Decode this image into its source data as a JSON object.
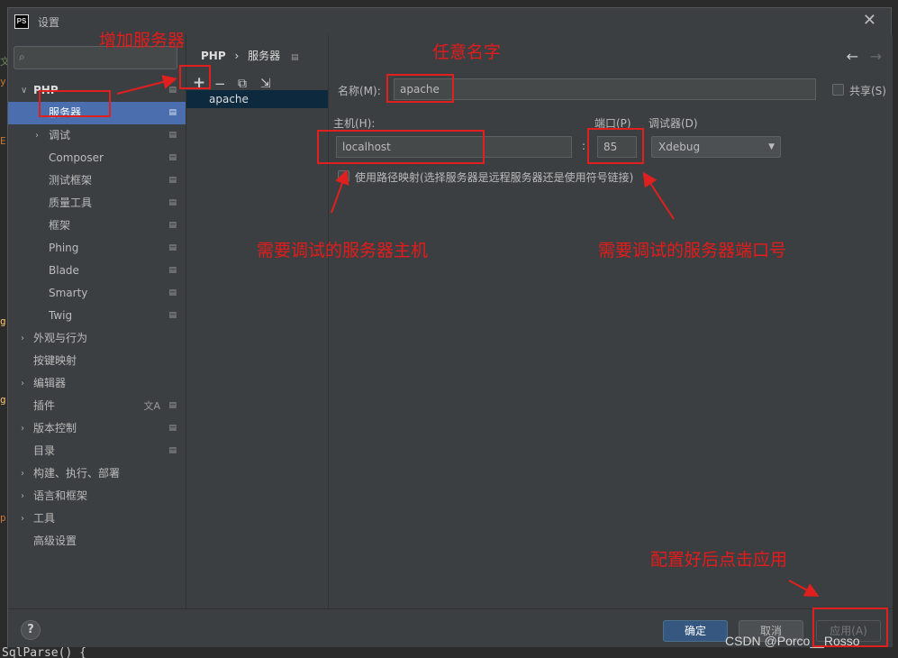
{
  "window": {
    "title": "设置",
    "logo": "PS"
  },
  "sidebar": {
    "search_placeholder": "",
    "items": [
      {
        "label": "PHP",
        "arrow": "∨"
      },
      {
        "label": "服务器"
      },
      {
        "label": "调试",
        "arrow": "›"
      },
      {
        "label": "Composer"
      },
      {
        "label": "测试框架"
      },
      {
        "label": "质量工具"
      },
      {
        "label": "框架"
      },
      {
        "label": "Phing"
      },
      {
        "label": "Blade"
      },
      {
        "label": "Smarty"
      },
      {
        "label": "Twig"
      },
      {
        "label": "外观与行为",
        "arrow": "›"
      },
      {
        "label": "按键映射"
      },
      {
        "label": "编辑器",
        "arrow": "›"
      },
      {
        "label": "插件"
      },
      {
        "label": "版本控制",
        "arrow": "›"
      },
      {
        "label": "目录"
      },
      {
        "label": "构建、执行、部署",
        "arrow": "›"
      },
      {
        "label": "语言和框架",
        "arrow": "›"
      },
      {
        "label": "工具",
        "arrow": "›"
      },
      {
        "label": "高级设置"
      }
    ]
  },
  "breadcrumb": {
    "root": "PHP",
    "sep": "›",
    "current": "服务器"
  },
  "toolbar": {
    "add": "+",
    "remove": "−",
    "copy": "⧉",
    "import": "⇲"
  },
  "servers": [
    {
      "name": "apache"
    }
  ],
  "form": {
    "name_label": "名称(M):",
    "name_value": "apache",
    "share_label": "共享(S)",
    "host_label": "主机(H):",
    "host_value": "localhost",
    "colon": ":",
    "port_label": "端口(P)",
    "port_value": "85",
    "debugger_label": "调试器(D)",
    "debugger_value": "Xdebug",
    "path_mapping_label": "使用路径映射(选择服务器是远程服务器还是使用符号链接)"
  },
  "footer": {
    "help": "?",
    "ok": "确定",
    "cancel": "取消",
    "apply": "应用(A)"
  },
  "annotations": {
    "add_server": "增加服务器",
    "any_name": "任意名字",
    "host_note": "需要调试的服务器主机",
    "port_note": "需要调试的服务器端口号",
    "apply_note": "配置好后点击应用"
  },
  "watermark": "CSDN @Porco__Rosso",
  "editor_snippet": "SqlParse() {",
  "colors": {
    "selection": "#4b6eaf",
    "annotation": "#e0201e",
    "ok_button": "#365880"
  }
}
